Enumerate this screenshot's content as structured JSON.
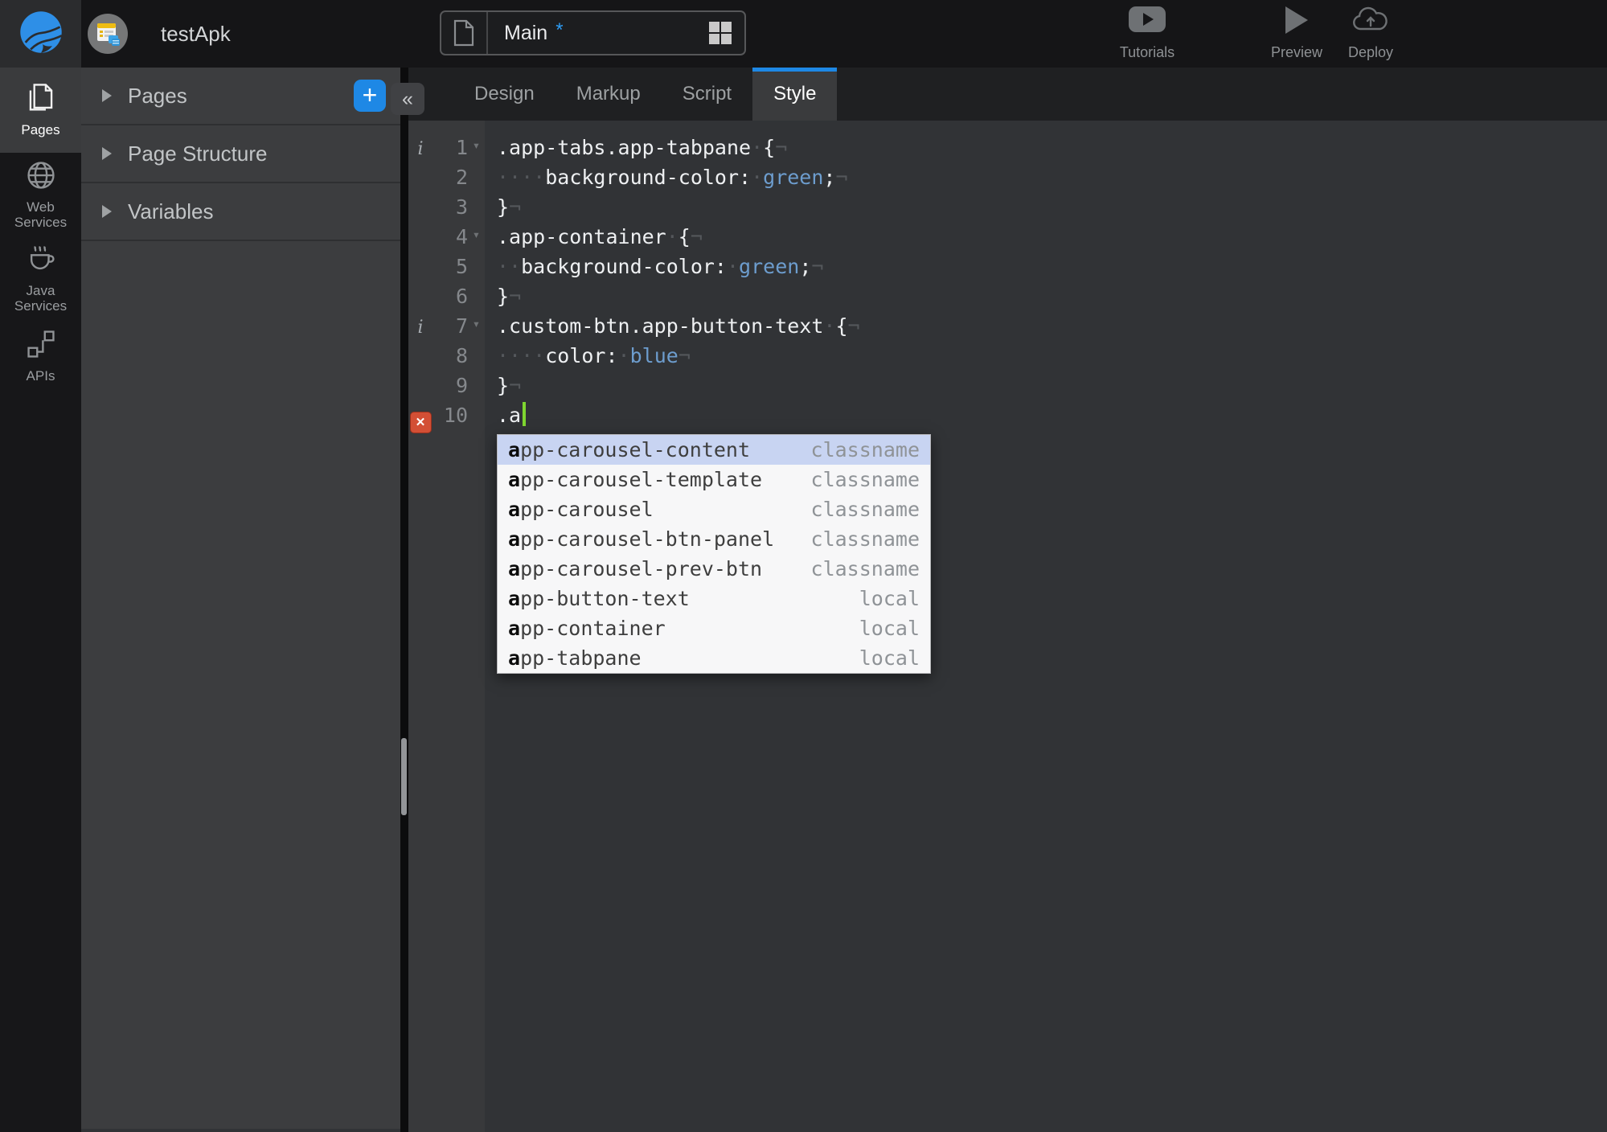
{
  "topbar": {
    "app_name": "testApk",
    "page_tab": {
      "name": "Main",
      "dirty_marker": "*"
    },
    "actions": {
      "tutorials": "Tutorials",
      "preview": "Preview",
      "deploy": "Deploy"
    }
  },
  "sidebar": {
    "items": [
      {
        "label": "Pages",
        "active": true
      },
      {
        "label": "Web Services",
        "active": false
      },
      {
        "label": "Java Services",
        "active": false
      },
      {
        "label": "APIs",
        "active": false
      }
    ]
  },
  "panel": {
    "sections": [
      {
        "label": "Pages"
      },
      {
        "label": "Page Structure"
      },
      {
        "label": "Variables"
      }
    ],
    "add_button_label": "+",
    "collapse_label": "«"
  },
  "editor": {
    "tabs": [
      {
        "label": "Design",
        "active": false
      },
      {
        "label": "Markup",
        "active": false
      },
      {
        "label": "Script",
        "active": false
      },
      {
        "label": "Style",
        "active": true
      }
    ],
    "info_glyph": "i",
    "fold_glyph": "▾",
    "error_glyph": "✕",
    "lines": [
      {
        "n": 1,
        "info": true,
        "fold": true,
        "tokens": [
          {
            "s": ".app-tabs.app-tabpane",
            "c": "plain"
          },
          {
            "s": "·",
            "c": "ws"
          },
          {
            "s": "{",
            "c": "plain"
          },
          {
            "s": "¬",
            "c": "ws"
          }
        ]
      },
      {
        "n": 2,
        "tokens": [
          {
            "s": "····",
            "c": "ws"
          },
          {
            "s": "background-color:",
            "c": "plain"
          },
          {
            "s": "·",
            "c": "ws"
          },
          {
            "s": "green",
            "c": "value"
          },
          {
            "s": ";",
            "c": "plain"
          },
          {
            "s": "¬",
            "c": "ws"
          }
        ]
      },
      {
        "n": 3,
        "tokens": [
          {
            "s": "}",
            "c": "plain"
          },
          {
            "s": "¬",
            "c": "ws"
          }
        ]
      },
      {
        "n": 4,
        "fold": true,
        "tokens": [
          {
            "s": ".app-container",
            "c": "plain"
          },
          {
            "s": "·",
            "c": "ws"
          },
          {
            "s": "{",
            "c": "plain"
          },
          {
            "s": "¬",
            "c": "ws"
          }
        ]
      },
      {
        "n": 5,
        "tokens": [
          {
            "s": "··",
            "c": "ws"
          },
          {
            "s": "background-color:",
            "c": "plain"
          },
          {
            "s": "·",
            "c": "ws"
          },
          {
            "s": "green",
            "c": "value"
          },
          {
            "s": ";",
            "c": "plain"
          },
          {
            "s": "¬",
            "c": "ws"
          }
        ]
      },
      {
        "n": 6,
        "tokens": [
          {
            "s": "}",
            "c": "plain"
          },
          {
            "s": "¬",
            "c": "ws"
          }
        ]
      },
      {
        "n": 7,
        "info": true,
        "fold": true,
        "tokens": [
          {
            "s": ".custom-btn.app-button-text",
            "c": "plain"
          },
          {
            "s": "·",
            "c": "ws"
          },
          {
            "s": "{",
            "c": "plain"
          },
          {
            "s": "¬",
            "c": "ws"
          }
        ]
      },
      {
        "n": 8,
        "tokens": [
          {
            "s": "····",
            "c": "ws"
          },
          {
            "s": "color:",
            "c": "plain"
          },
          {
            "s": "·",
            "c": "ws"
          },
          {
            "s": "blue",
            "c": "value"
          },
          {
            "s": "¬",
            "c": "ws"
          }
        ]
      },
      {
        "n": 9,
        "tokens": [
          {
            "s": "}",
            "c": "plain"
          },
          {
            "s": "¬",
            "c": "ws"
          }
        ]
      },
      {
        "n": 10,
        "error": true,
        "cursor": true,
        "tokens": [
          {
            "s": ".a",
            "c": "plain"
          }
        ]
      }
    ]
  },
  "autocomplete": {
    "match_prefix": "a",
    "selected_index": 0,
    "items": [
      {
        "name": "app-carousel-content",
        "type": "classname"
      },
      {
        "name": "app-carousel-template",
        "type": "classname"
      },
      {
        "name": "app-carousel",
        "type": "classname"
      },
      {
        "name": "app-carousel-btn-panel",
        "type": "classname"
      },
      {
        "name": "app-carousel-prev-btn",
        "type": "classname"
      },
      {
        "name": "app-button-text",
        "type": "local"
      },
      {
        "name": "app-container",
        "type": "local"
      },
      {
        "name": "app-tabpane",
        "type": "local"
      }
    ]
  },
  "colors": {
    "accent_blue": "#1e88e5",
    "dirty_star_blue": "#2d9cf4",
    "css_value_blue": "#6d9dce",
    "cursor_green": "#7fd630",
    "error_red": "#d34f35",
    "autocomplete_selection": "#c8d4f2",
    "panel_bg": "#3c3d3f",
    "editor_bg": "#313336",
    "topbar_bg": "#151517"
  }
}
